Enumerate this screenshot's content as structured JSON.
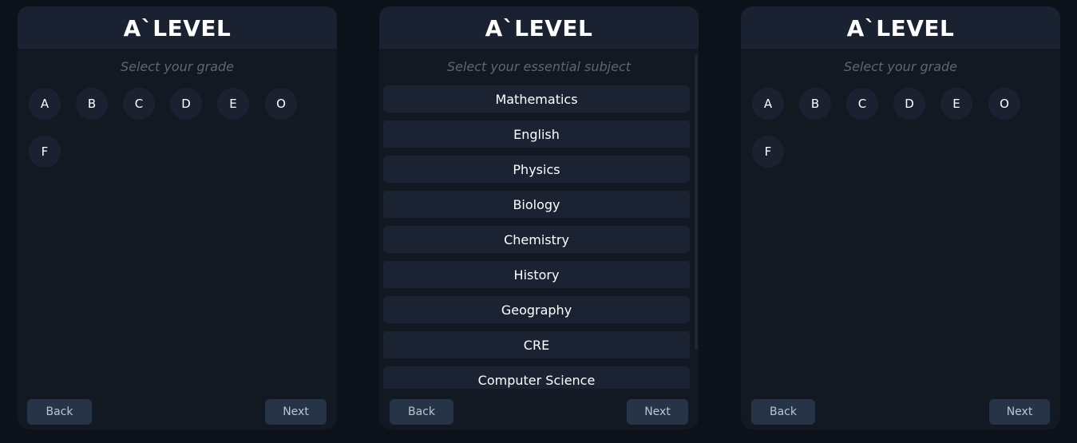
{
  "brand": "A`LEVEL",
  "cards": [
    {
      "prompt": "Select your grade",
      "grades": [
        "A",
        "B",
        "C",
        "D",
        "E",
        "O",
        "F"
      ],
      "back_label": "Back",
      "next_label": "Next"
    },
    {
      "prompt": "Select your essential subject",
      "subjects": [
        "Mathematics",
        "English",
        "Physics",
        "Biology",
        "Chemistry",
        "History",
        "Geography",
        "CRE",
        "Computer Science"
      ],
      "back_label": "Back",
      "next_label": "Next"
    },
    {
      "prompt": "Select your grade",
      "grades": [
        "A",
        "B",
        "C",
        "D",
        "E",
        "O",
        "F"
      ],
      "back_label": "Back",
      "next_label": "Next"
    }
  ],
  "colors": {
    "page_background": "#0c111a",
    "card_background": "#121923",
    "header_background": "#1a2130",
    "option_background": "#1b2332",
    "button_background": "#273447"
  }
}
